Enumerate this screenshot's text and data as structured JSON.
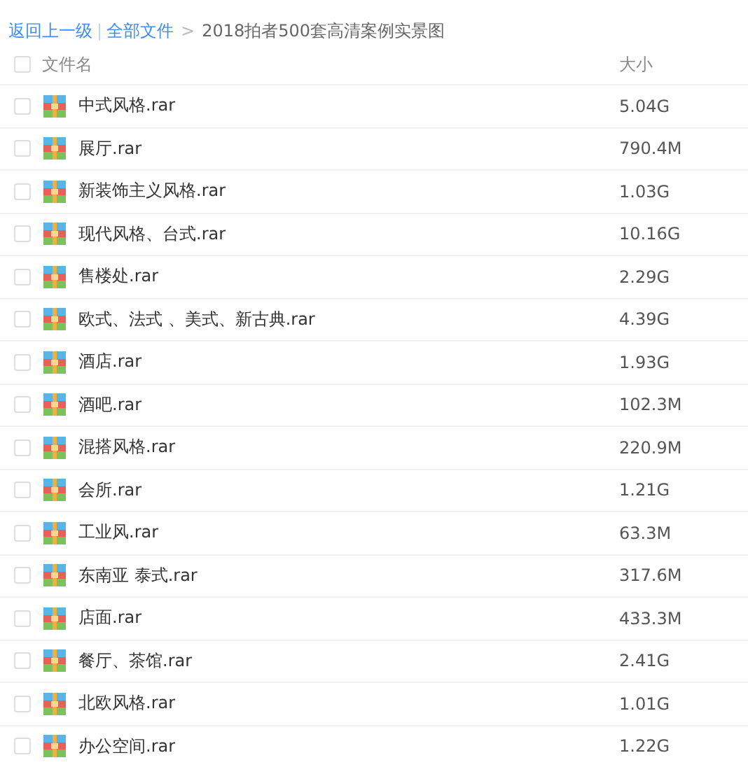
{
  "breadcrumb": {
    "back": "返回上一级",
    "separator": "|",
    "root": "全部文件",
    "arrow": ">",
    "current": "2018拍者500套高清案例实景图"
  },
  "table": {
    "columns": [
      "文件名",
      "大小"
    ],
    "header_checked": false,
    "rows": [
      {
        "name": "中式风格.rar",
        "size": "5.04G",
        "checked": false
      },
      {
        "name": "展厅.rar",
        "size": "790.4M",
        "checked": false
      },
      {
        "name": "新装饰主义风格.rar",
        "size": "1.03G",
        "checked": false
      },
      {
        "name": "现代风格、台式.rar",
        "size": "10.16G",
        "checked": false
      },
      {
        "name": "售楼处.rar",
        "size": "2.29G",
        "checked": false
      },
      {
        "name": "欧式、法式 、美式、新古典.rar",
        "size": "4.39G",
        "checked": false
      },
      {
        "name": "酒店.rar",
        "size": "1.93G",
        "checked": false
      },
      {
        "name": "酒吧.rar",
        "size": "102.3M",
        "checked": false
      },
      {
        "name": "混搭风格.rar",
        "size": "220.9M",
        "checked": false
      },
      {
        "name": "会所.rar",
        "size": "1.21G",
        "checked": false
      },
      {
        "name": "工业风.rar",
        "size": "63.3M",
        "checked": false
      },
      {
        "name": "东南亚 泰式.rar",
        "size": "317.6M",
        "checked": false
      },
      {
        "name": "店面.rar",
        "size": "433.3M",
        "checked": false
      },
      {
        "name": "餐厅、茶馆.rar",
        "size": "2.41G",
        "checked": false
      },
      {
        "name": "北欧风格.rar",
        "size": "1.01G",
        "checked": false
      },
      {
        "name": "办公空间.rar",
        "size": "1.22G",
        "checked": false
      }
    ]
  }
}
